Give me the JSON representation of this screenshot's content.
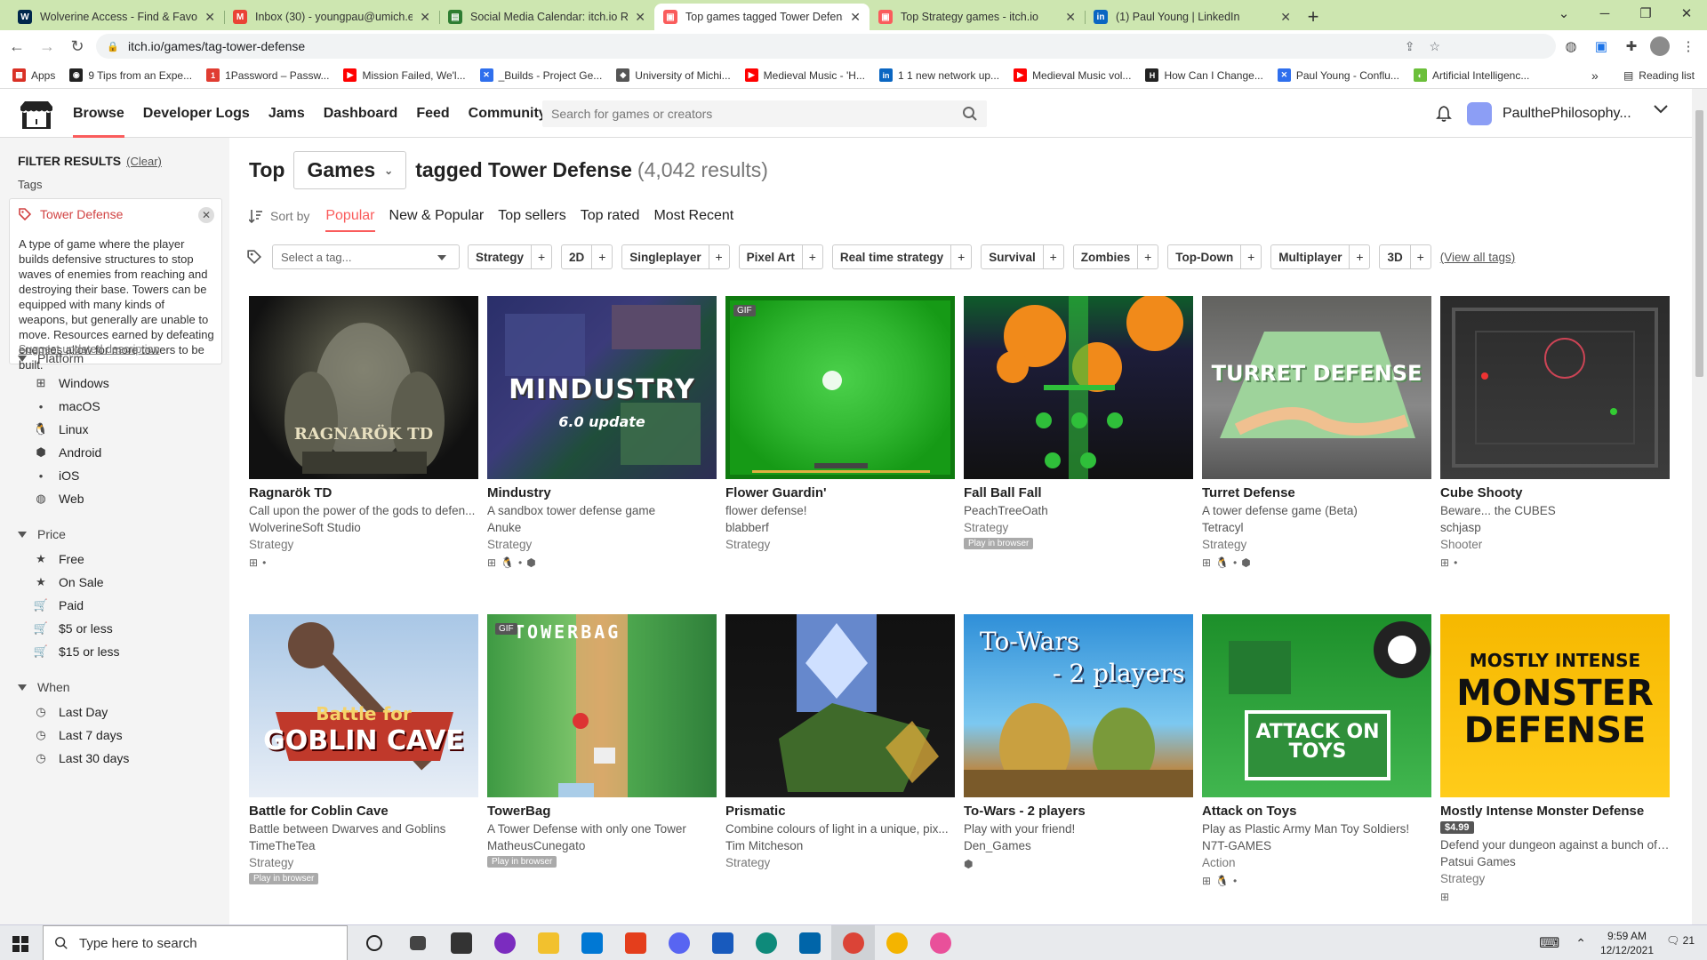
{
  "browser": {
    "tabs": [
      {
        "title": "Wolverine Access - Find & Favori",
        "fav_color": "#00274c",
        "fav": "W",
        "active": false
      },
      {
        "title": "Inbox (30) - youngpau@umich.e",
        "fav_color": "#ea4335",
        "fav": "M",
        "active": false
      },
      {
        "title": "Social Media Calendar: itch.io Ra",
        "fav_color": "#2e7d32",
        "fav": "▤",
        "active": false
      },
      {
        "title": "Top games tagged Tower Defens",
        "fav_color": "#fa5c5c",
        "fav": "▣",
        "active": true
      },
      {
        "title": "Top Strategy games - itch.io",
        "fav_color": "#fa5c5c",
        "fav": "▣",
        "active": false
      },
      {
        "title": "(1) Paul Young | LinkedIn",
        "fav_color": "#0a66c2",
        "fav": "in",
        "active": false
      }
    ],
    "url": "itch.io/games/tag-tower-defense",
    "bookmarks": [
      {
        "label": "Apps",
        "color": "#d93025",
        "icon": "▦"
      },
      {
        "label": "9 Tips from an Expe...",
        "color": "#222",
        "icon": "◉"
      },
      {
        "label": "1Password – Passw...",
        "color": "#e03c31",
        "icon": "1"
      },
      {
        "label": "Mission Failed, We'l...",
        "color": "#ff0000",
        "icon": "▶"
      },
      {
        "label": "_Builds - Project Ge...",
        "color": "#2f6fed",
        "icon": "✕"
      },
      {
        "label": "University of Michi...",
        "color": "#555",
        "icon": "◆"
      },
      {
        "label": "Medieval Music - 'H...",
        "color": "#ff0000",
        "icon": "▶"
      },
      {
        "label": "1 1 new network up...",
        "color": "#0a66c2",
        "icon": "in"
      },
      {
        "label": "Medieval Music vol...",
        "color": "#ff0000",
        "icon": "▶"
      },
      {
        "label": "How Can I Change...",
        "color": "#222",
        "icon": "H"
      },
      {
        "label": "Paul Young - Conflu...",
        "color": "#2f6fed",
        "icon": "✕"
      },
      {
        "label": "Artificial Intelligenc...",
        "color": "#6bbf3a",
        "icon": "◐"
      }
    ],
    "more": "»",
    "reading_list": "Reading list"
  },
  "site": {
    "nav": [
      "Browse",
      "Developer Logs",
      "Jams",
      "Dashboard",
      "Feed",
      "Community"
    ],
    "search_placeholder": "Search for games or creators",
    "username": "PaulthePhilosophy..."
  },
  "sidebar": {
    "filter_title": "FILTER RESULTS",
    "clear": "(Clear)",
    "tags_label": "Tags",
    "tag": {
      "name": "Tower Defense",
      "description": "A type of game where the player builds defensive structures to stop waves of enemies from reaching and destroying their base. Towers can be equipped with many kinds of weapons, but generally are unable to move. Resources earned by defeating enemies allow for more towers to be built.",
      "suggest": "Suggest updated description"
    },
    "platform": {
      "title": "Platform",
      "items": [
        {
          "label": "Windows",
          "icon": "windows-icon"
        },
        {
          "label": "macOS",
          "icon": "apple-icon"
        },
        {
          "label": "Linux",
          "icon": "linux-icon"
        },
        {
          "label": "Android",
          "icon": "android-icon"
        },
        {
          "label": "iOS",
          "icon": "apple-icon"
        },
        {
          "label": "Web",
          "icon": "globe-icon"
        }
      ]
    },
    "price": {
      "title": "Price",
      "items": [
        {
          "label": "Free",
          "icon": "star-icon"
        },
        {
          "label": "On Sale",
          "icon": "star-icon"
        },
        {
          "label": "Paid",
          "icon": "cart-icon"
        },
        {
          "label": "$5 or less",
          "icon": "cart-icon"
        },
        {
          "label": "$15 or less",
          "icon": "cart-icon"
        }
      ]
    },
    "when": {
      "title": "When",
      "items": [
        {
          "label": "Last Day",
          "icon": "clock-icon"
        },
        {
          "label": "Last 7 days",
          "icon": "clock-icon"
        },
        {
          "label": "Last 30 days",
          "icon": "clock-icon"
        }
      ]
    }
  },
  "main": {
    "title_top": "Top",
    "games_dropdown": "Games",
    "title_tagged": "tagged Tower Defense",
    "results": "(4,042 results)",
    "sort_by": "Sort by",
    "sort_options": [
      "Popular",
      "New & Popular",
      "Top sellers",
      "Top rated",
      "Most Recent"
    ],
    "active_sort": "Popular",
    "tag_select_placeholder": "Select a tag...",
    "tag_pills": [
      "Strategy",
      "2D",
      "Singleplayer",
      "Pixel Art",
      "Real time strategy",
      "Survival",
      "Zombies",
      "Top-Down",
      "Multiplayer",
      "3D"
    ],
    "view_all_tags": "(View all tags)",
    "games": [
      {
        "title": "Ragnarök TD",
        "desc": "Call upon the power of the gods to defen...",
        "author": "WolverineSoft Studio",
        "genre": "Strategy",
        "platforms": [
          "windows-icon",
          "apple-icon"
        ],
        "art": "ragnarok",
        "overlay": "RAGNARÖK TD"
      },
      {
        "title": "Mindustry",
        "desc": "A sandbox tower defense game",
        "author": "Anuke",
        "genre": "Strategy",
        "platforms": [
          "windows-icon",
          "linux-icon",
          "apple-icon",
          "android-icon"
        ],
        "art": "mindustry",
        "overlay": "MINDUSTRY",
        "overlay2": "6.0 update"
      },
      {
        "title": "Flower Guardin'",
        "desc": "flower defense!",
        "author": "blabberf",
        "genre": "Strategy",
        "platforms": [],
        "art": "flower",
        "gif": "GIF"
      },
      {
        "title": "Fall Ball Fall",
        "desc": "",
        "author": "PeachTreeOath",
        "genre": "Strategy",
        "platforms": [],
        "art": "fallball",
        "badge": "Play in browser"
      },
      {
        "title": "Turret Defense",
        "desc": "A tower defense game (Beta)",
        "author": "Tetracyl",
        "genre": "Strategy",
        "platforms": [
          "windows-icon",
          "linux-icon",
          "apple-icon",
          "android-icon"
        ],
        "art": "turret",
        "overlay": "TURRET DEFENSE"
      },
      {
        "title": "Cube Shooty",
        "desc": "Beware... the CUBES",
        "author": "schjasp",
        "genre": "Shooter",
        "platforms": [
          "windows-icon",
          "apple-icon"
        ],
        "art": "cube"
      },
      {
        "title": "Battle for Coblin Cave",
        "desc": "Battle between Dwarves and Goblins",
        "author": "TimeTheTea",
        "genre": "Strategy",
        "platforms": [],
        "art": "goblin",
        "badge": "Play in browser",
        "overlay": "Battle for",
        "overlay2": "GOBLIN CAVE"
      },
      {
        "title": "TowerBag",
        "desc": "A Tower Defense with only one Tower",
        "author": "MatheusCunegato",
        "genre": "",
        "platforms": [],
        "art": "towerbag",
        "gif": "GIF",
        "badge": "Play in browser",
        "overlay": "TOWERBAG"
      },
      {
        "title": "Prismatic",
        "desc": "Combine colours of light in a unique, pix...",
        "author": "Tim Mitcheson",
        "genre": "Strategy",
        "platforms": [],
        "art": "prismatic"
      },
      {
        "title": "To-Wars - 2 players",
        "desc": "Play with your friend!",
        "author": "Den_Games",
        "genre": "",
        "platforms": [
          "android-icon"
        ],
        "art": "towars",
        "overlay": "To-Wars",
        "overlay2": "- 2 players"
      },
      {
        "title": "Attack on Toys",
        "desc": "Play as Plastic Army Man Toy Soldiers!",
        "author": "N7T-GAMES",
        "genre": "Action",
        "platforms": [
          "windows-icon",
          "linux-icon",
          "apple-icon"
        ],
        "art": "toys",
        "overlay": "ATTACK ON TOYS"
      },
      {
        "title": "Mostly Intense Monster Defense",
        "desc": "Defend your dungeon against a bunch of ...",
        "author": "Patsui Games",
        "genre": "Strategy",
        "platforms": [
          "windows-icon"
        ],
        "art": "monster",
        "price": "$4.99",
        "overlay": "MOSTLY INTENSE",
        "overlay2": "MONSTER DEFENSE"
      }
    ]
  },
  "taskbar": {
    "search_placeholder": "Type here to search",
    "time": "9:59 AM",
    "date": "12/12/2021",
    "notif_count": "21"
  }
}
